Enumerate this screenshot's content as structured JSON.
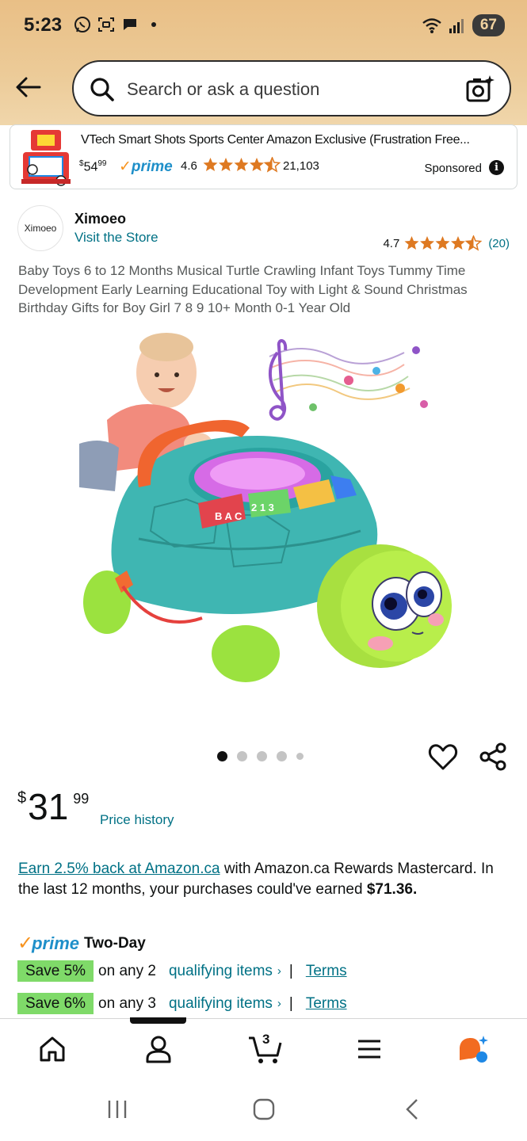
{
  "status_bar": {
    "time": "5:23",
    "battery": "67",
    "icons": [
      "whatsapp-icon",
      "screenshot-icon",
      "chat-icon",
      "dot-icon",
      "wifi-icon",
      "signal-icon"
    ]
  },
  "search": {
    "placeholder": "Search or ask a question",
    "icons": [
      "back-arrow-icon",
      "search-icon",
      "camera-icon"
    ]
  },
  "sponsored": {
    "title": "VTech Smart Shots Sports Center Amazon Exclusive (Frustration Free...",
    "price_currency": "$",
    "price_whole": "54",
    "price_fraction": "99",
    "prime_label": "prime",
    "rating": "4.6",
    "rating_stars": 4.5,
    "review_count": "21,103",
    "label": "Sponsored",
    "info_symbol": "i"
  },
  "store": {
    "logo_text": "Ximoeo",
    "name": "Ximoeo",
    "link": "Visit the Store",
    "rating": "4.7",
    "rating_stars": 4.5,
    "review_count": "(20)"
  },
  "product": {
    "title": "Baby Toys 6 to 12 Months Musical Turtle Crawling Infant Toys Tummy Time Development Early Learning Educational Toy with Light & Sound Christmas Birthday Gifts for Boy Girl 7 8 9 10+ Month 0-1 Year Old",
    "image_count": 5,
    "active_image": 1,
    "shell_labels": [
      "B A C",
      "2 1 3"
    ]
  },
  "price": {
    "currency": "$",
    "whole": "31",
    "fraction": "99",
    "history_link": "Price history"
  },
  "rewards": {
    "link": "Earn 2.5% back at Amazon.ca",
    "text": " with Amazon.ca Rewards Mastercard. In the last 12 months, your purchases could've earned ",
    "amount": "$71.36."
  },
  "prime": {
    "logo": "prime",
    "label": "Two-Day"
  },
  "offers": [
    {
      "badge": "Save 5%",
      "text": "on any 2",
      "link": "qualifying items",
      "separator": "|",
      "terms": "Terms"
    },
    {
      "badge": "Save 6%",
      "text": "on any 3",
      "link": "qualifying items",
      "separator": "|",
      "terms": "Terms"
    }
  ],
  "bottom_nav": {
    "items": [
      "home-icon",
      "account-icon",
      "cart-icon",
      "menu-icon",
      "rufus-icon"
    ],
    "cart_count": "3"
  },
  "colors": {
    "link": "#007185",
    "star": "#de7921",
    "prime": "#1e8fc9",
    "save_badge": "#7fda69",
    "header": "#e9bf86"
  }
}
